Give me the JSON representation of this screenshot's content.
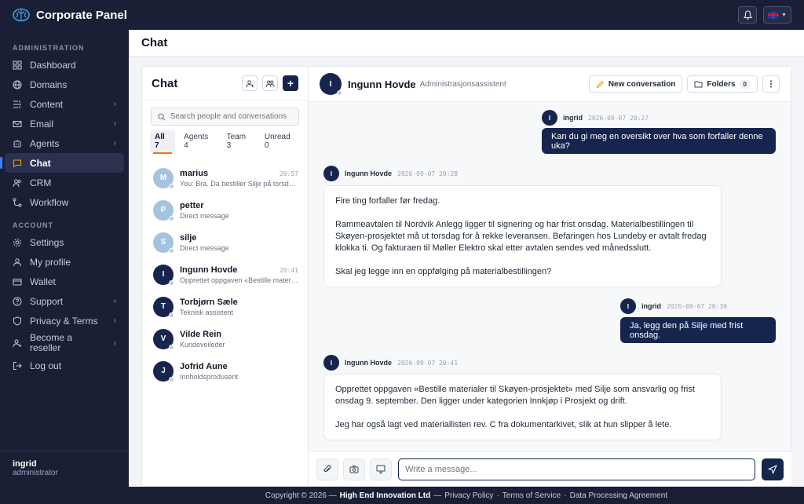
{
  "app": {
    "title": "Corporate Panel",
    "language_flag": "flag-uk-icon"
  },
  "sidebar": {
    "admin_label": "ADMINISTRATION",
    "admin_items": [
      {
        "label": "Dashboard",
        "icon": "dashboard-icon",
        "chevron": false
      },
      {
        "label": "Domains",
        "icon": "globe-icon",
        "chevron": false
      },
      {
        "label": "Content",
        "icon": "content-icon",
        "chevron": true
      },
      {
        "label": "Email",
        "icon": "mail-icon",
        "chevron": true
      },
      {
        "label": "Agents",
        "icon": "agents-icon",
        "chevron": true
      },
      {
        "label": "Chat",
        "icon": "chat-icon",
        "chevron": false,
        "active": true
      },
      {
        "label": "CRM",
        "icon": "users-icon",
        "chevron": false
      },
      {
        "label": "Workflow",
        "icon": "workflow-icon",
        "chevron": false
      }
    ],
    "account_label": "ACCOUNT",
    "account_items": [
      {
        "label": "Settings",
        "icon": "gear-icon",
        "chevron": false
      },
      {
        "label": "My profile",
        "icon": "user-icon",
        "chevron": false
      },
      {
        "label": "Wallet",
        "icon": "wallet-icon",
        "chevron": false
      },
      {
        "label": "Support",
        "icon": "help-icon",
        "chevron": true
      },
      {
        "label": "Privacy & Terms",
        "icon": "shield-icon",
        "chevron": true
      },
      {
        "label": "Become a reseller",
        "icon": "user-plus-icon",
        "chevron": true
      },
      {
        "label": "Log out",
        "icon": "logout-icon",
        "chevron": false
      }
    ],
    "user": {
      "name": "ingrid",
      "role": "administrator"
    }
  },
  "page": {
    "title": "Chat"
  },
  "conversations": {
    "title": "Chat",
    "search_placeholder": "Search people and conversations",
    "filters": [
      {
        "label": "All",
        "count": "7",
        "active": true
      },
      {
        "label": "Agents",
        "count": "4"
      },
      {
        "label": "Team",
        "count": "3"
      },
      {
        "label": "Unread",
        "count": "0"
      }
    ],
    "items": [
      {
        "initial": "M",
        "name": "marius",
        "time": "20:57",
        "sub": "You: Bra. Da bestiller Silje på torsdag.",
        "style": "light"
      },
      {
        "initial": "P",
        "name": "petter",
        "time": "",
        "sub": "Direct message",
        "style": "light"
      },
      {
        "initial": "S",
        "name": "silje",
        "time": "",
        "sub": "Direct message",
        "style": "light"
      },
      {
        "initial": "I",
        "name": "Ingunn Hovde",
        "time": "20:41",
        "sub": "Opprettet oppgaven «Bestille materi…",
        "style": "dark"
      },
      {
        "initial": "T",
        "name": "Torbjørn Sæle",
        "time": "",
        "sub": "Teknisk assistent",
        "style": "dark"
      },
      {
        "initial": "V",
        "name": "Vilde Rein",
        "time": "",
        "sub": "Kundeveileder",
        "style": "dark"
      },
      {
        "initial": "J",
        "name": "Jofrid Aune",
        "time": "",
        "sub": "Innholdsprodusent",
        "style": "dark"
      }
    ]
  },
  "chat": {
    "contact": {
      "initial": "I",
      "name": "Ingunn Hovde",
      "role": "Administrasjonsassistent"
    },
    "new_conversation": "New conversation",
    "folders": "Folders",
    "folders_count": "0",
    "messages": [
      {
        "direction": "out",
        "initial": "I",
        "author": "ingrid",
        "time": "2026-09-07 20:27",
        "paragraphs": [
          "Kan du gi meg en oversikt over hva som forfaller denne uka?"
        ]
      },
      {
        "direction": "in",
        "initial": "I",
        "author": "Ingunn Hovde",
        "time": "2026-09-07 20:28",
        "paragraphs": [
          "Fire ting forfaller før fredag.",
          "Rammeavtalen til Nordvik Anlegg ligger til signering og har frist onsdag. Materialbestillingen til Skøyen-prosjektet må ut torsdag for å rekke leveransen. Befaringen hos Lundeby er avtalt fredag klokka ti. Og fakturaen til Møller Elektro skal etter avtalen sendes ved månedsslutt.",
          "Skal jeg legge inn en oppfølging på materialbestillingen?"
        ]
      },
      {
        "direction": "out",
        "initial": "I",
        "author": "ingrid",
        "time": "2026-09-07 20:39",
        "paragraphs": [
          "Ja, legg den på Silje med frist onsdag."
        ]
      },
      {
        "direction": "in",
        "initial": "I",
        "author": "Ingunn Hovde",
        "time": "2026-09-07 20:41",
        "paragraphs": [
          "Opprettet oppgaven «Bestille materialer til Skøyen-prosjektet» med Silje som ansvarlig og frist onsdag 9. september. Den ligger under kategorien Innkjøp i Prosjekt og drift.",
          "Jeg har også lagt ved materiallisten rev. C fra dokumentarkivet, slik at hun slipper å lete."
        ]
      }
    ],
    "composer_placeholder": "Write a message..."
  },
  "footer": {
    "copyright": "Copyright © 2026 —",
    "company": "High End Innovation Ltd",
    "sep": "—",
    "links": [
      "Privacy Policy",
      "Terms of Service",
      "Data Processing Agreement"
    ],
    "link_sep": "·"
  },
  "colors": {
    "sidebar_bg": "#1b1f36",
    "accent_navy": "#15254e",
    "active_indicator": "#3b82f6",
    "filter_underline": "#f97316"
  }
}
